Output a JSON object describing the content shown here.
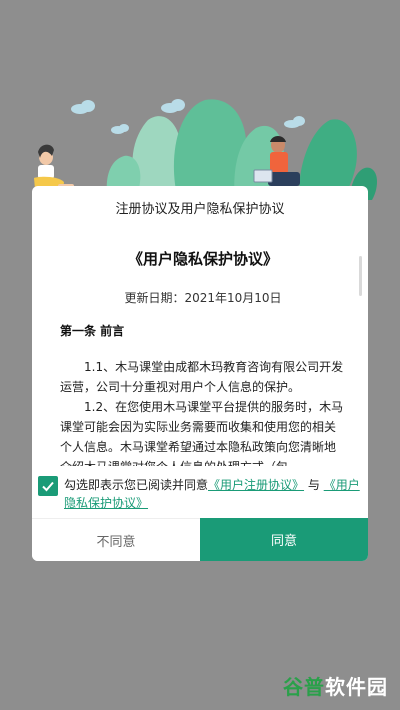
{
  "dialog": {
    "title": "注册协议及用户隐私保护协议",
    "doc_title": "《用户隐私保护协议》",
    "updated_date": "更新日期：2021年10月10日",
    "section_title": "第一条  前言",
    "paragraphs": [
      "1.1、木马课堂由成都木玛教育咨询有限公司开发运营，公司十分重视对用户个人信息的保护。",
      "1.2、在您使用木马课堂平台提供的服务时，木马课堂可能会因为实际业务需要而收集和使用您的相关个人信息。木马课堂希望通过本隐私政策向您清晰地介绍木马课堂对您个人信息的处理方式（包"
    ],
    "agreement": {
      "checked": true,
      "prefix": "勾选即表示您已阅读并同意",
      "link1": "《用户注册协议》",
      "connector": "与",
      "link2": "《用户隐私保护协议》"
    },
    "buttons": {
      "disagree": "不同意",
      "agree": "同意"
    }
  },
  "watermark": {
    "part1": "谷普",
    "part2": "软件园"
  },
  "colors": {
    "accent": "#1a9b77",
    "overlay": "#8e8e8e"
  }
}
